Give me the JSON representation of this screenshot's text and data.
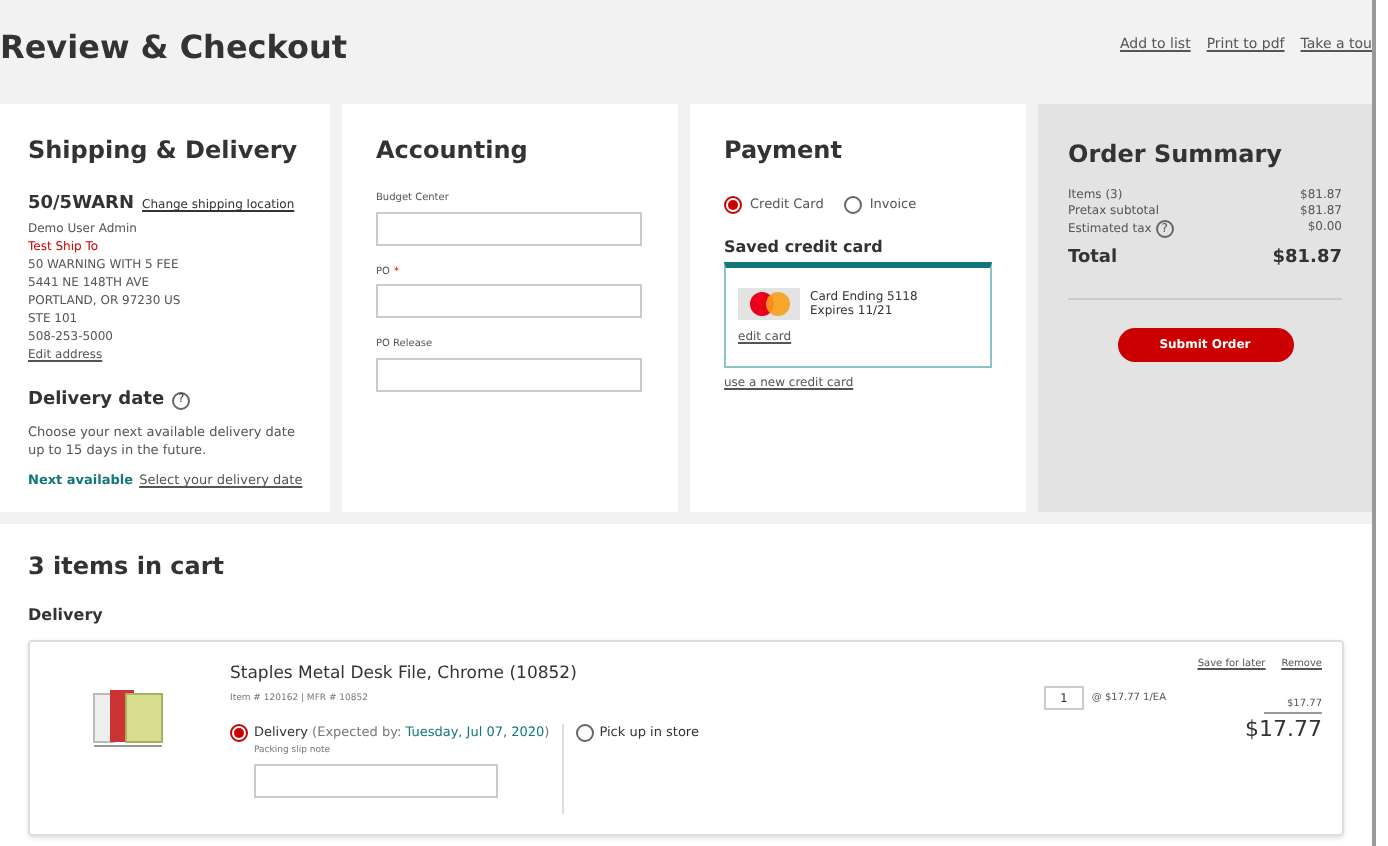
{
  "page_title": "Review & Checkout",
  "header_links": [
    "Add to list",
    "Print to pdf",
    "Take a tou"
  ],
  "shipping": {
    "title": "Shipping & Delivery",
    "location_code": "50/5WARN",
    "change_link": "Change shipping location",
    "address_lines": [
      {
        "text": "Demo User Admin",
        "highlight": false
      },
      {
        "text": "Test Ship To",
        "highlight": true
      },
      {
        "text": "50 WARNING WITH 5 FEE",
        "highlight": false
      },
      {
        "text": "5441 NE 148TH AVE",
        "highlight": false
      },
      {
        "text": "PORTLAND, OR 97230 US",
        "highlight": false
      },
      {
        "text": "STE 101",
        "highlight": false
      },
      {
        "text": "508-253-5000",
        "highlight": false
      }
    ],
    "edit_link": "Edit address",
    "delivery_title": "Delivery date",
    "help_icon": "?",
    "delivery_text": "Choose your next available delivery date up to 15 days in the future.",
    "next_label": "Next available",
    "select_link": "Select your delivery date"
  },
  "accounting": {
    "title": "Accounting",
    "fields": [
      {
        "label": "Budget Center",
        "required": false
      },
      {
        "label": "PO",
        "required": true
      },
      {
        "label": "PO Release",
        "required": false
      }
    ],
    "required_mark": "*"
  },
  "payment": {
    "title": "Payment",
    "methods": [
      {
        "label": "Credit Card",
        "selected": true
      },
      {
        "label": "Invoice",
        "selected": false
      }
    ],
    "saved_title": "Saved credit card",
    "card": {
      "line1": "Card Ending 5118",
      "line2": "Expires 11/21",
      "edit_link": "edit card",
      "selected": true
    },
    "new_card_link": "use a new credit card"
  },
  "summary": {
    "title": "Order Summary",
    "rows": [
      {
        "label": "Items (3)",
        "value": "$81.87",
        "help": false
      },
      {
        "label": "Pretax subtotal",
        "value": "$81.87",
        "help": false
      },
      {
        "label": "Estimated tax",
        "value": "$0.00",
        "help": true
      }
    ],
    "help_icon": "?",
    "total_label": "Total",
    "total_value": "$81.87",
    "submit": "Submit Order"
  },
  "cart": {
    "title": "3 items in cart",
    "group": "Delivery",
    "items": [
      {
        "name": "Staples Metal Desk File, Chrome (10852)",
        "meta": "Item # 120162 | MFR # 10852",
        "options": [
          {
            "label": "Delivery",
            "detail": "(Expected by: ",
            "date": "Tuesday, Jul 07, 2020",
            "close": ")",
            "selected": true
          },
          {
            "label": "Pick up in store",
            "selected": false
          }
        ],
        "note_label": "Packing slip note",
        "save_link": "Save for later",
        "remove_link": "Remove",
        "qty": "1",
        "unit_price": "@ $17.77 1/EA",
        "list_price": "$17.77",
        "price": "$17.77"
      }
    ]
  }
}
